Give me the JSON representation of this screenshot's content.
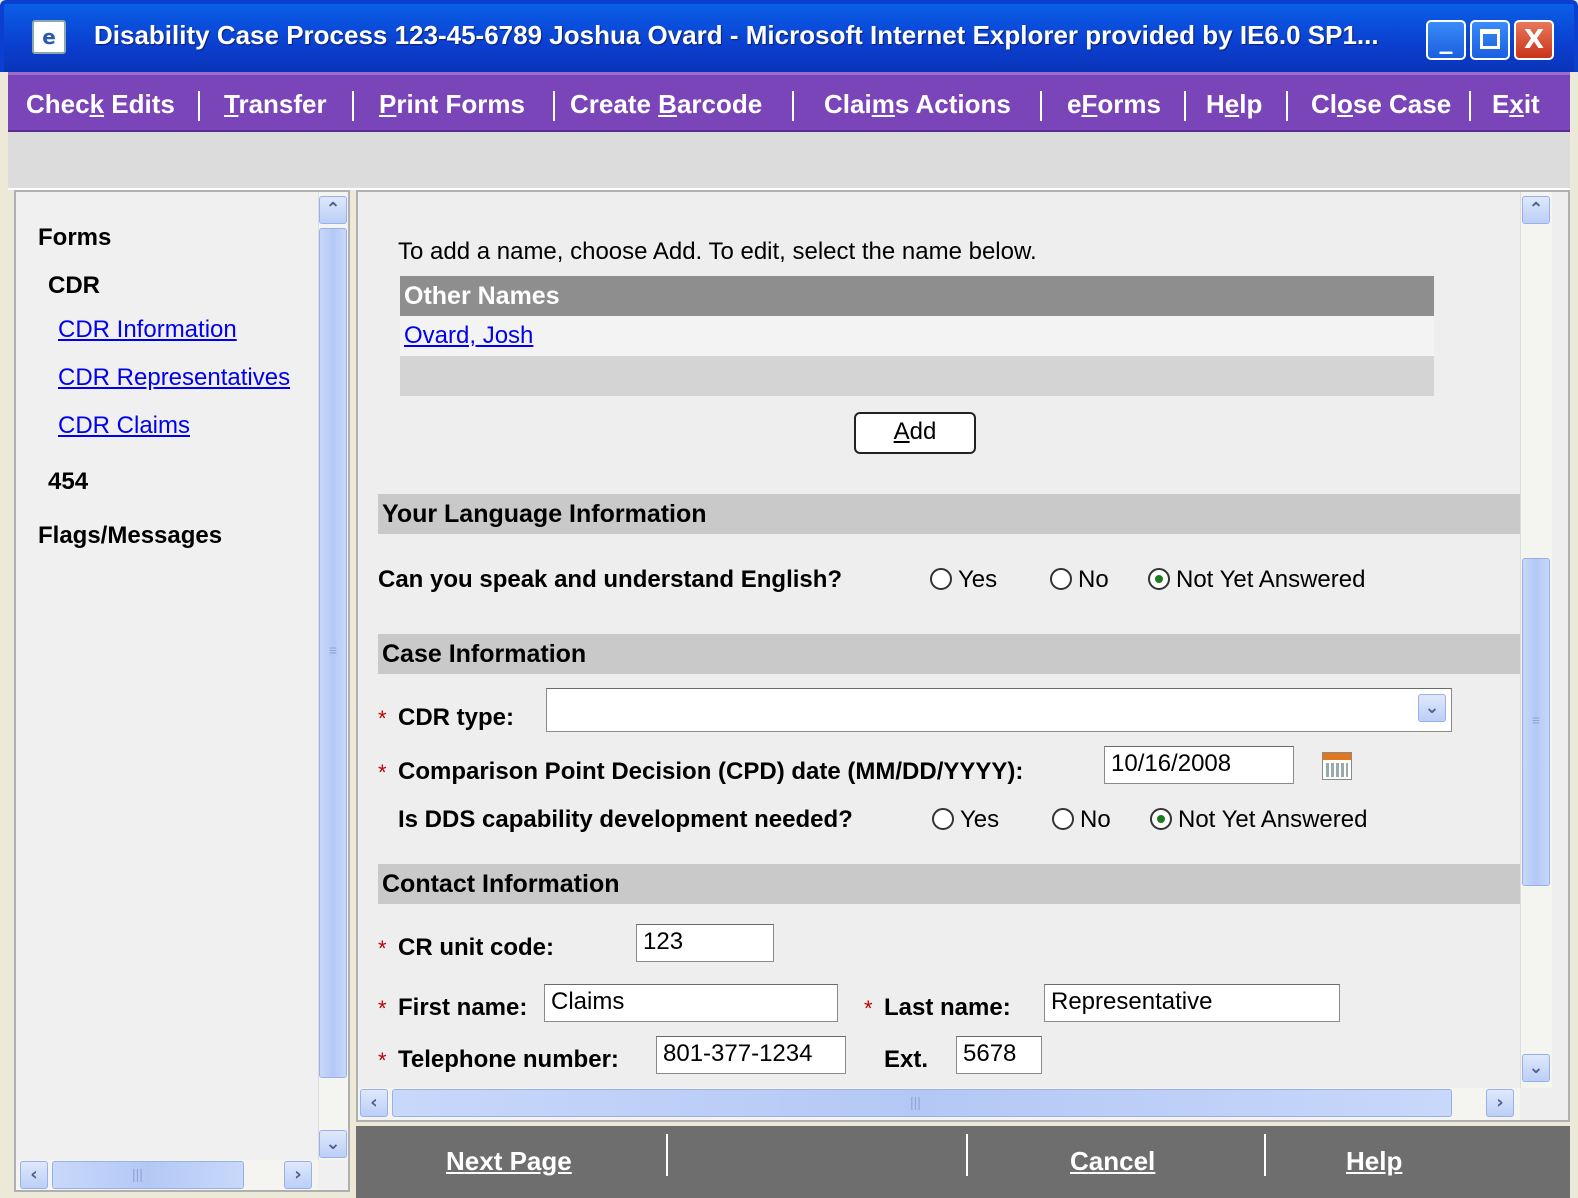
{
  "window": {
    "title": "Disability Case Process 123-45-6789 Joshua Ovard  -  Microsoft Internet Explorer provided by IE6.0 SP1...",
    "icon": "ie-document-icon"
  },
  "menu": [
    {
      "pre": "Chec",
      "key": "k",
      "post": " Edits"
    },
    {
      "pre": "",
      "key": "T",
      "post": "ransfer"
    },
    {
      "pre": "",
      "key": "P",
      "post": "rint Forms"
    },
    {
      "pre": "Create ",
      "key": "B",
      "post": "arcode"
    },
    {
      "pre": "Clai",
      "key": "m",
      "post": "s Actions"
    },
    {
      "pre": "e",
      "key": "F",
      "post": "orms"
    },
    {
      "pre": "H",
      "key": "e",
      "post": "lp"
    },
    {
      "pre": "Cl",
      "key": "o",
      "post": "se Case"
    },
    {
      "pre": "E",
      "key": "x",
      "post": "it"
    }
  ],
  "nav": {
    "forms": "Forms",
    "cdr": "CDR",
    "links": [
      "CDR Information",
      "CDR Representatives",
      "CDR Claims"
    ],
    "n454": "454",
    "flags": "Flags/Messages"
  },
  "other_names": {
    "instruction": "To add a name, choose Add.  To edit, select the name below.",
    "header": "Other Names",
    "rows": [
      "Ovard, Josh"
    ],
    "add_pre": "",
    "add_key": "A",
    "add_post": "dd"
  },
  "language": {
    "section": "Your Language Information",
    "question": "Can you speak and understand English?",
    "options": [
      "Yes",
      "No",
      "Not Yet Answered"
    ],
    "selected": "Not Yet Answered"
  },
  "case": {
    "section": "Case Information",
    "cdr_type_label": "CDR type:",
    "cdr_type_value": "",
    "cpd_label": "Comparison Point Decision (CPD) date (MM/DD/YYYY):",
    "cpd_value": "10/16/2008",
    "dds_label": "Is DDS capability development needed?",
    "dds_options": [
      "Yes",
      "No",
      "Not Yet Answered"
    ],
    "dds_selected": "Not Yet Answered"
  },
  "contact": {
    "section": "Contact Information",
    "unit_label": "CR unit code:",
    "unit_value": "123",
    "first_label": "First name:",
    "first_value": "Claims",
    "last_label": "Last name:",
    "last_value": "Representative",
    "phone_label": "Telephone number:",
    "phone_value": "801-377-1234",
    "ext_label": "Ext.",
    "ext_value": "5678"
  },
  "required_marker": "*",
  "bottom": {
    "next": {
      "key": "N",
      "post": "ext Page"
    },
    "cancel": {
      "key": "C",
      "post": "ancel"
    },
    "help": {
      "key": "H",
      "post": "elp"
    }
  },
  "colors": {
    "title_bar": "#0b3fd0",
    "menu_bar": "#7a45b8",
    "section_bar": "#c9c9c9",
    "link": "#0000ee",
    "bottom_bar": "#6e6e6e"
  }
}
